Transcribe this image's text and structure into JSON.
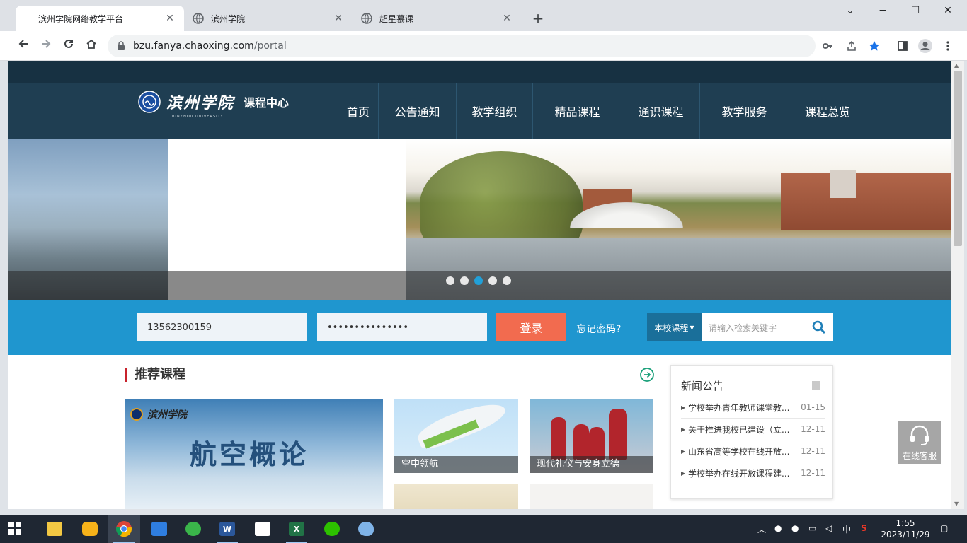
{
  "browser": {
    "tabs": [
      {
        "title": "滨州学院网络教学平台",
        "close": "✕",
        "active": true
      },
      {
        "title": "滨州学院",
        "close": "✕",
        "active": false
      },
      {
        "title": "超星慕课",
        "close": "✕",
        "active": false
      }
    ],
    "new_tab": "+",
    "window": {
      "minimize": "−",
      "maximize": "☐",
      "close": "✕",
      "tabsearch": "⌄"
    },
    "url_host": "bzu.fanya.chaoxing.com",
    "url_path": "/portal"
  },
  "site": {
    "logo_cn": "滨州学院",
    "logo_en": "BINZHOU UNIVERSITY",
    "logo_sub": "课程中心",
    "nav": [
      "首页",
      "公告通知",
      "教学组织",
      "精品课程",
      "通识课程",
      "教学服务",
      "课程总览"
    ],
    "carousel": {
      "count": 5,
      "active": 2
    }
  },
  "login": {
    "username": "13562300159",
    "password": "•••••••••••••••",
    "login_label": "登录",
    "forgot_label": "忘记密码?",
    "scope_label": "本校课程",
    "search_placeholder": "请输入检索关键字"
  },
  "recommended": {
    "title": "推荐课程",
    "featured": {
      "logo": "滨州学院",
      "title": "航空概论"
    },
    "cards": [
      "空中领航",
      "现代礼仪与安身立德"
    ]
  },
  "news": {
    "title": "新闻公告",
    "items": [
      {
        "title": "学校举办青年教师课堂教...",
        "date": "01-15"
      },
      {
        "title": "关于推进我校已建设（立...",
        "date": "12-11"
      },
      {
        "title": "山东省高等学校在线开放...",
        "date": "12-11"
      },
      {
        "title": "学校举办在线开放课程建...",
        "date": "12-11"
      }
    ]
  },
  "service": {
    "label": "在线客服"
  },
  "taskbar": {
    "tray_lang": "中",
    "time": "1:55",
    "date": "2023/11/29"
  },
  "colors": {
    "header": "#1f3e52",
    "login_bar": "#1f96cf",
    "login_button": "#f26b4f",
    "accent_red": "#c8232c",
    "dot_active": "#21a0d8"
  }
}
